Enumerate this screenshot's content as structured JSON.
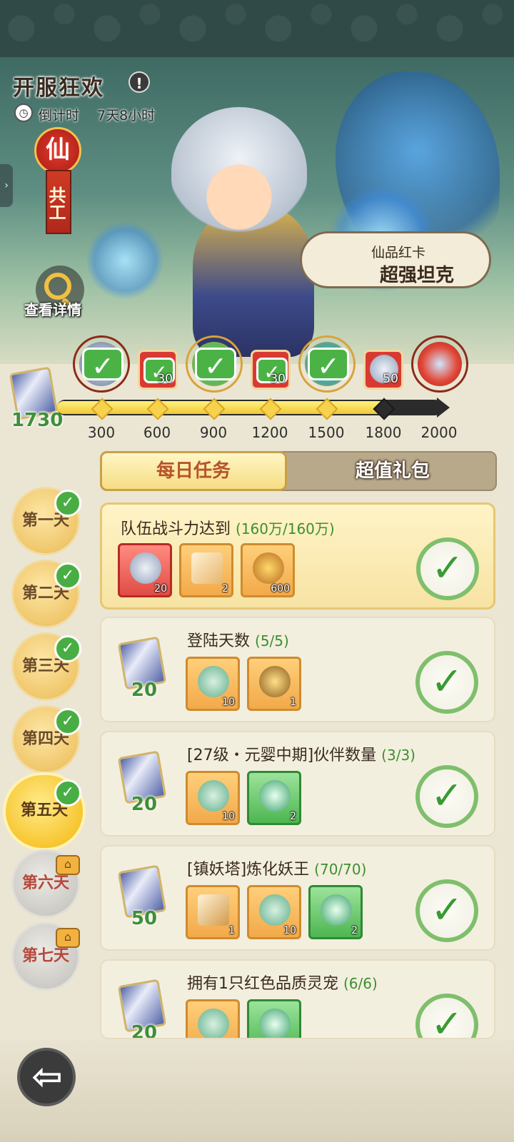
{
  "header": {
    "title": "开服狂欢",
    "countdown_label": "倒计时",
    "countdown_value": "7天8小时"
  },
  "hero": {
    "rank_badge": "仙",
    "hero_type": "共工",
    "view_detail": "查看详情",
    "card_quality": "仙品红卡",
    "card_tagline": "超强坦克"
  },
  "progress": {
    "current_points": "1730",
    "current_value": 1730,
    "max_value": 2000,
    "ticks": [
      "300",
      "600",
      "900",
      "1200",
      "1500",
      "1800",
      "2000"
    ],
    "rewards": [
      {
        "tier": "300",
        "claimed": true,
        "count": ""
      },
      {
        "tier": "600",
        "claimed": true,
        "count": "30"
      },
      {
        "tier": "900",
        "claimed": true,
        "count": ""
      },
      {
        "tier": "1200",
        "claimed": true,
        "count": "30"
      },
      {
        "tier": "1500",
        "claimed": true,
        "count": ""
      },
      {
        "tier": "1800",
        "claimed": false,
        "count": "50"
      },
      {
        "tier": "2000",
        "claimed": false,
        "count": ""
      }
    ]
  },
  "tabs": {
    "daily": "每日任务",
    "gift": "超值礼包",
    "active": "daily"
  },
  "days": [
    {
      "label": "第一天",
      "state": "done"
    },
    {
      "label": "第二天",
      "state": "done"
    },
    {
      "label": "第三天",
      "state": "done"
    },
    {
      "label": "第四天",
      "state": "done"
    },
    {
      "label": "第五天",
      "state": "active"
    },
    {
      "label": "第六天",
      "state": "locked"
    },
    {
      "label": "第七天",
      "state": "locked"
    }
  ],
  "tasks": [
    {
      "title": "队伍战斗力达到",
      "progress": "(160万/160万)",
      "points": "",
      "items": [
        {
          "count": "20",
          "style": "red"
        },
        {
          "count": "2",
          "style": "orange"
        },
        {
          "count": "600",
          "style": "orange"
        }
      ],
      "completed": true
    },
    {
      "title": "登陆天数",
      "progress": "(5/5)",
      "points": "20",
      "items": [
        {
          "count": "10",
          "style": "orange"
        },
        {
          "count": "1",
          "style": "orange"
        }
      ],
      "completed": true
    },
    {
      "title": "[27级・元婴中期]伙伴数量",
      "progress": "(3/3)",
      "points": "20",
      "items": [
        {
          "count": "10",
          "style": "orange"
        },
        {
          "count": "2",
          "style": "green"
        }
      ],
      "completed": true
    },
    {
      "title": "[镇妖塔]炼化妖王",
      "progress": "(70/70)",
      "points": "50",
      "items": [
        {
          "count": "1",
          "style": "orange"
        },
        {
          "count": "10",
          "style": "orange"
        },
        {
          "count": "2",
          "style": "green"
        }
      ],
      "completed": true
    },
    {
      "title": "拥有1只红色品质灵宠",
      "progress": "(6/6)",
      "points": "20",
      "items": [
        {
          "count": "",
          "style": "orange"
        },
        {
          "count": "",
          "style": "green"
        }
      ],
      "completed": true
    }
  ],
  "icons": {
    "check": "✓",
    "info": "!",
    "back": "⇦",
    "lock": "⌂"
  },
  "colors": {
    "green_progress": "#3b8f2f",
    "tab_active_text": "#b6542a",
    "rank_red": "#e63b2e"
  }
}
